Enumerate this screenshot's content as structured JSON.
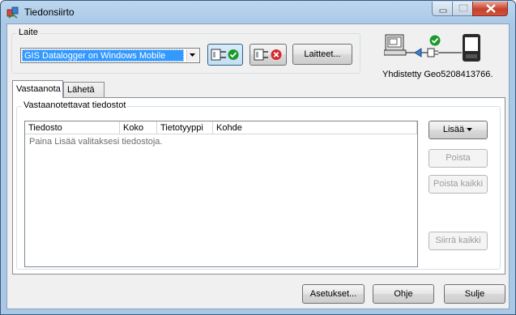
{
  "window": {
    "title": "Tiedonsiirto"
  },
  "device_group": {
    "label": "Laite",
    "device_select": {
      "selected": "GIS Datalogger on Windows Mobile"
    },
    "connect_icon": "connect-plug-check-icon",
    "disconnect_icon": "disconnect-plug-x-icon",
    "devices_button": "Laitteet..."
  },
  "status": {
    "icon": "pc-to-device-connected-icon",
    "text": "Yhdistetty Geo5208413766."
  },
  "tabs": [
    {
      "label": "Vastaanota",
      "active": true
    },
    {
      "label": "Lähetä",
      "active": false
    }
  ],
  "receive": {
    "group_label": "Vastaanotettavat tiedostot",
    "columns": [
      "Tiedosto",
      "Koko",
      "Tietotyyppi",
      "Kohde"
    ],
    "empty_message": "Paina Lisää valitaksesi tiedostoja.",
    "buttons": {
      "add": "Lisää",
      "remove": "Poista",
      "remove_all": "Poista kaikki",
      "transfer_all": "Siirrä kaikki"
    }
  },
  "footer": {
    "settings": "Asetukset...",
    "help": "Ohje",
    "close": "Sulje"
  },
  "colors": {
    "selection": "#3399ff",
    "title_bar": "#bcd6ef",
    "check_green": "#1a9a2a",
    "error_red": "#d32a2a"
  }
}
